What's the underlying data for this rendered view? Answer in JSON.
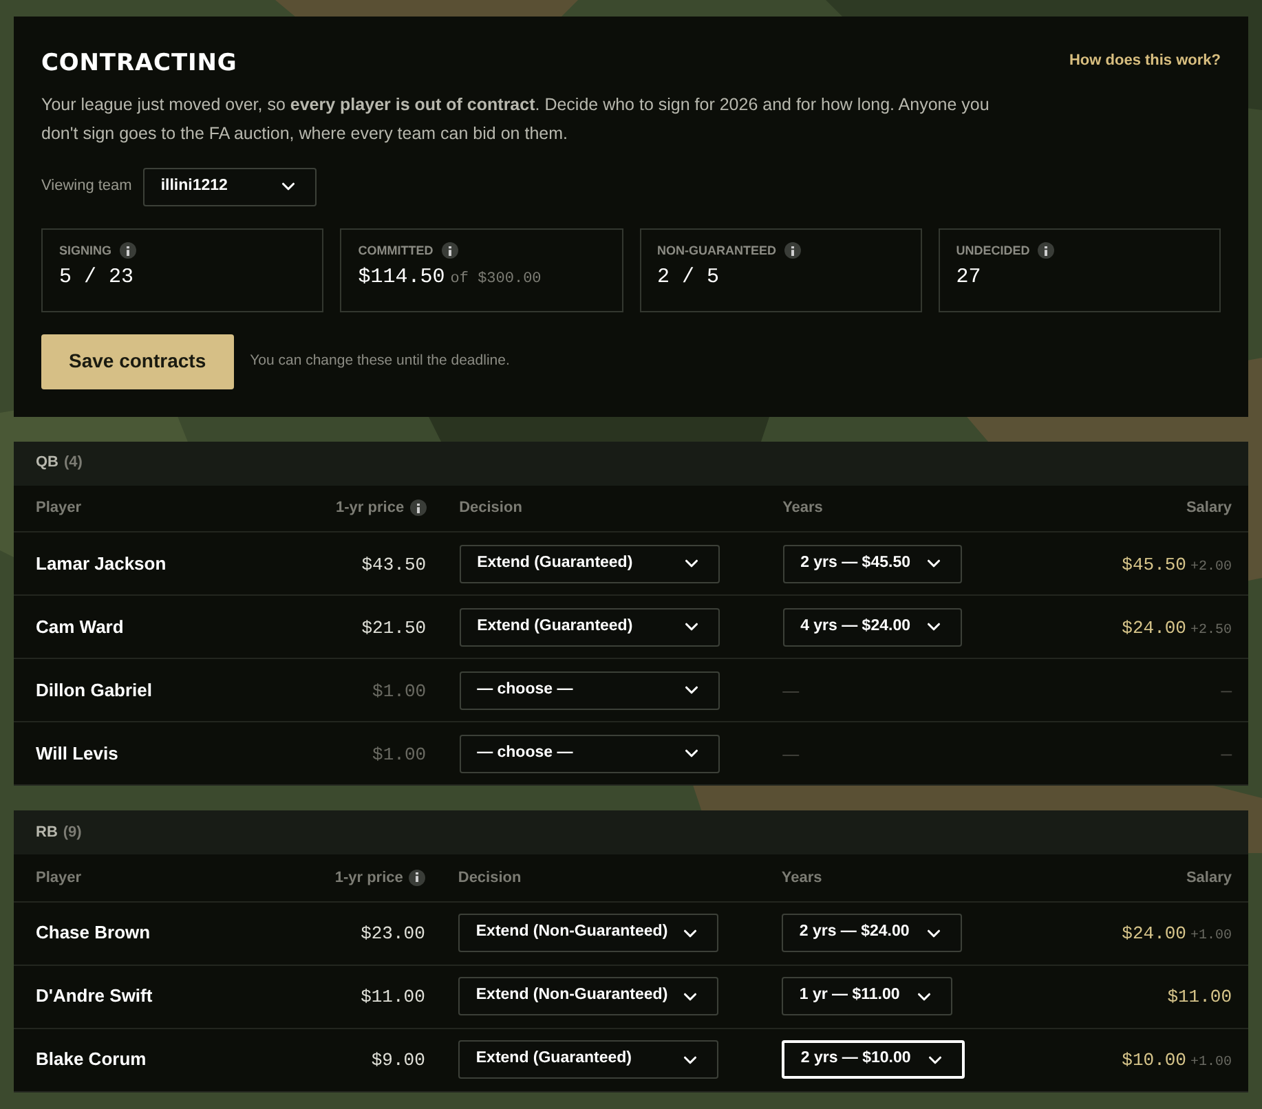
{
  "header": {
    "title": "CONTRACTING",
    "help_link": "How does this work?",
    "intro": "Your league just moved over, so **every player is out of contract**. Decide who to sign for 2026 and for how long. Anyone you don't sign goes to the FA auction, where every team can bid on them.",
    "team_label": "Viewing team",
    "team_value": "illini1212"
  },
  "stats": [
    {
      "label": "SIGNING",
      "value": "5 / 23"
    },
    {
      "label": "COMMITTED",
      "value": "$114.50",
      "suffix": "of $300.00"
    },
    {
      "label": "NON-GUARANTEED",
      "value": "2 / 5"
    },
    {
      "label": "UNDECIDED",
      "value": "27"
    }
  ],
  "save_button": "Save contracts",
  "save_note": "You can change these until the deadline.",
  "sections": [
    {
      "position": "QB",
      "count": "(4)",
      "columns": [
        "Player",
        "1-yr price",
        "Decision",
        "Years",
        "Salary"
      ],
      "rows": [
        {
          "player": "Lamar Jackson",
          "price": "$43.50",
          "decision": "Extend (Guaranteed)",
          "years": "2 yrs — $45.50",
          "years_focused": false,
          "salary": "$45.50",
          "raise": "+2.00",
          "decided": true
        },
        {
          "player": "Cam Ward",
          "price": "$21.50",
          "decision": "Extend (Guaranteed)",
          "years": "4 yrs — $24.00",
          "years_focused": false,
          "salary": "$24.00",
          "raise": "+2.50",
          "decided": true
        },
        {
          "player": "Dillon Gabriel",
          "price": "$1.00",
          "decision": "— choose —",
          "years_dash": "—",
          "salary": "—",
          "decided": false
        },
        {
          "player": "Will Levis",
          "price": "$1.00",
          "decision": "— choose —",
          "years_dash": "—",
          "salary": "—",
          "decided": false
        }
      ]
    },
    {
      "position": "RB",
      "count": "(9)",
      "columns": [
        "Player",
        "1-yr price",
        "Decision",
        "Years",
        "Salary"
      ],
      "rows": [
        {
          "player": "Chase Brown",
          "price": "$23.00",
          "decision": "Extend (Non-Guaranteed)",
          "years": "2 yrs — $24.00",
          "years_focused": false,
          "salary": "$24.00",
          "raise": "+1.00",
          "decided": true
        },
        {
          "player": "D'Andre Swift",
          "price": "$11.00",
          "decision": "Extend (Non-Guaranteed)",
          "years": "1 yr — $11.00",
          "years_focused": false,
          "salary": "$11.00",
          "decided": true
        },
        {
          "player": "Blake Corum",
          "price": "$9.00",
          "decision": "Extend (Guaranteed)",
          "years": "2 yrs — $10.00",
          "years_focused": true,
          "salary": "$10.00",
          "raise": "+1.00",
          "decided": true
        }
      ]
    }
  ]
}
